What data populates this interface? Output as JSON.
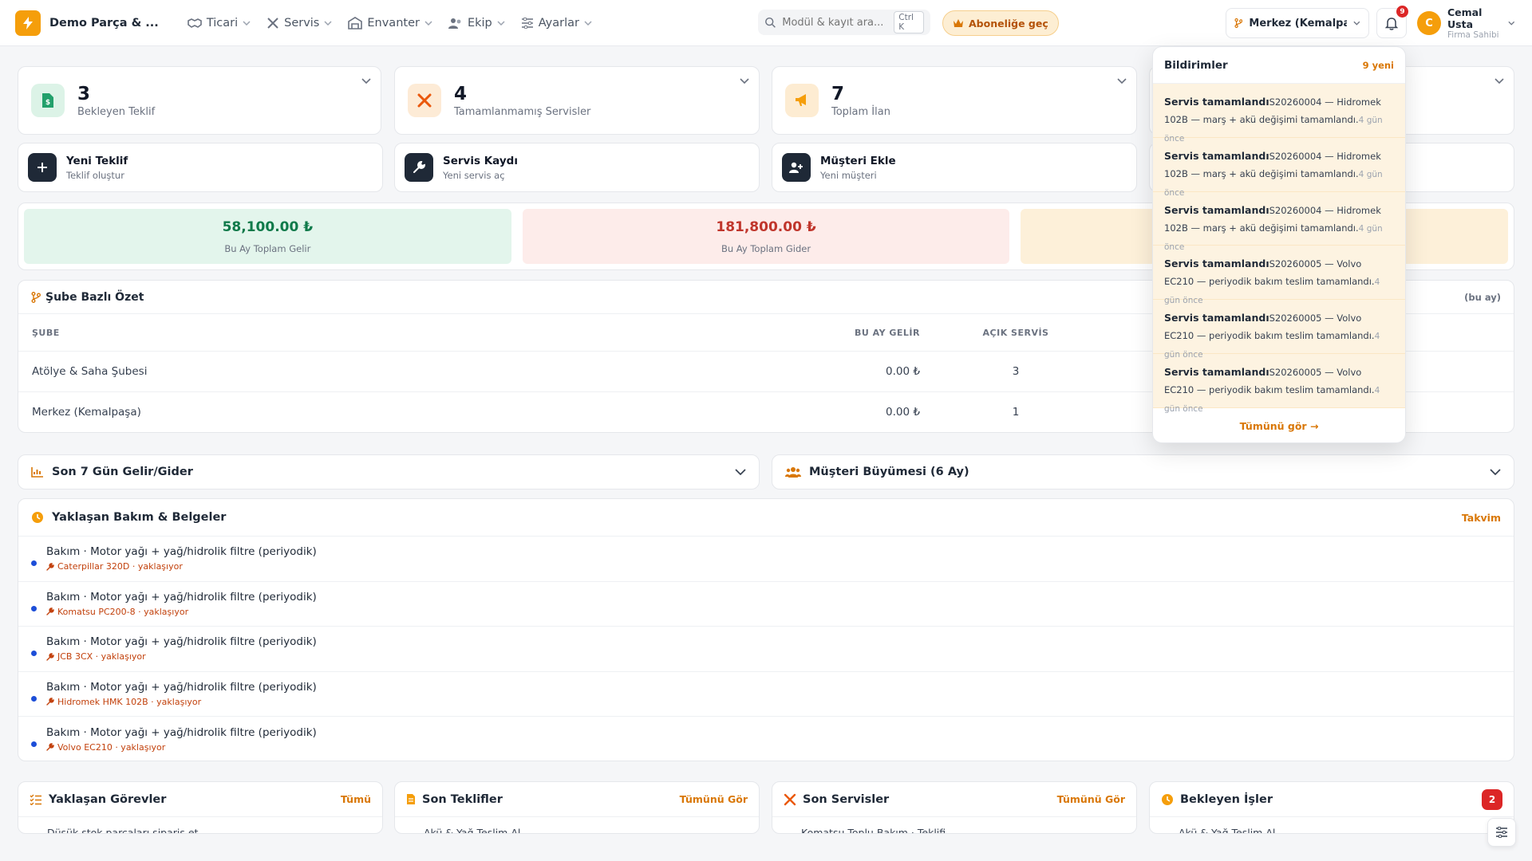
{
  "app": {
    "brand_name": "Demo Parça & ..."
  },
  "nav": [
    {
      "label": "Ticari",
      "icon": "handshake-icon"
    },
    {
      "label": "Servis",
      "icon": "tools-icon"
    },
    {
      "label": "Envanter",
      "icon": "warehouse-icon"
    },
    {
      "label": "Ekip",
      "icon": "team-icon"
    },
    {
      "label": "Ayarlar",
      "icon": "sliders-icon"
    }
  ],
  "search": {
    "placeholder": "Modül & kayıt ara...",
    "shortcut": "Ctrl K"
  },
  "upgrade": {
    "label": "Aboneliğe geç"
  },
  "branch": {
    "selected": "Merkez (Kemalpa..."
  },
  "notifications": {
    "badge": "9",
    "title": "Bildirimler",
    "new_count": "9 yeni",
    "items": [
      {
        "title": "Servis tamamlandı",
        "body": "S20260004 — Hidromek 102B — marş + akü değişimi tamamlandı.",
        "time": "4 gün önce"
      },
      {
        "title": "Servis tamamlandı",
        "body": "S20260004 — Hidromek 102B — marş + akü değişimi tamamlandı.",
        "time": "4 gün önce"
      },
      {
        "title": "Servis tamamlandı",
        "body": "S20260004 — Hidromek 102B — marş + akü değişimi tamamlandı.",
        "time": "4 gün önce"
      },
      {
        "title": "Servis tamamlandı",
        "body": "S20260005 — Volvo EC210 — periyodik bakım teslim tamamlandı.",
        "time": "4 gün önce"
      },
      {
        "title": "Servis tamamlandı",
        "body": "S20260005 — Volvo EC210 — periyodik bakım teslim tamamlandı.",
        "time": "4 gün önce"
      },
      {
        "title": "Servis tamamlandı",
        "body": "S20260005 — Volvo EC210 — periyodik bakım teslim tamamlandı.",
        "time": "4 gün önce"
      }
    ],
    "see_all": "Tümünü gör →"
  },
  "user": {
    "initial": "C",
    "name": "Cemal Usta",
    "role": "Firma Sahibi"
  },
  "stats": [
    {
      "value": "3",
      "label": "Bekleyen Teklif"
    },
    {
      "value": "4",
      "label": "Tamamlanmamış Servisler"
    },
    {
      "value": "7",
      "label": "Toplam İlan"
    }
  ],
  "actions": [
    {
      "title": "Yeni Teklif",
      "sub": "Teklif oluştur"
    },
    {
      "title": "Servis Kaydı",
      "sub": "Yeni servis aç"
    },
    {
      "title": "Müşteri Ekle",
      "sub": "Yeni müşteri"
    }
  ],
  "finance": [
    {
      "value": "58,100.00 ₺",
      "label": "Bu Ay Toplam Gelir",
      "color": "#0f7a4a",
      "bg": "#e3f5ec"
    },
    {
      "value": "181,800.00 ₺",
      "label": "Bu Ay Toplam Gider",
      "color": "#c0362c",
      "bg": "#fdecea"
    }
  ],
  "branch_summary": {
    "title": "Şube Bazlı Özet",
    "period": "(bu ay)",
    "columns": [
      "ŞUBE",
      "BU AY GELİR",
      "AÇIK SERVİS"
    ],
    "rows": [
      {
        "name": "Atölye & Saha Şubesi",
        "gelir": "0.00 ₺",
        "servis": "3"
      },
      {
        "name": "Merkez (Kemalpaşa)",
        "gelir": "0.00 ₺",
        "servis": "1"
      }
    ]
  },
  "collapsibles": {
    "income_expense": "Son 7 Gün Gelir/Gider",
    "customer_growth": "Müşteri Büyümesi (6 Ay)"
  },
  "maintenance": {
    "title": "Yaklaşan Bakım & Belgeler",
    "link": "Takvim",
    "items": [
      {
        "main": "Bakım · Motor yağı + yağ/hidrolik filtre (periyodik)",
        "sub": "Caterpillar 320D · yaklaşıyor"
      },
      {
        "main": "Bakım · Motor yağı + yağ/hidrolik filtre (periyodik)",
        "sub": "Komatsu PC200-8 · yaklaşıyor"
      },
      {
        "main": "Bakım · Motor yağı + yağ/hidrolik filtre (periyodik)",
        "sub": "JCB 3CX · yaklaşıyor"
      },
      {
        "main": "Bakım · Motor yağı + yağ/hidrolik filtre (periyodik)",
        "sub": "Hidromek HMK 102B · yaklaşıyor"
      },
      {
        "main": "Bakım · Motor yağı + yağ/hidrolik filtre (periyodik)",
        "sub": "Volvo EC210 · yaklaşıyor"
      }
    ]
  },
  "bottom_cards": [
    {
      "title": "Yaklaşan Görevler",
      "link": "Tümü",
      "peek": "Düşük stok parçaları sipariş et"
    },
    {
      "title": "Son Teklifler",
      "link": "Tümünü Gör",
      "peek": "Akü & Yağ Teslim Al..."
    },
    {
      "title": "Son Servisler",
      "link": "Tümünü Gör",
      "peek": "Komatsu Toplu Bakım · Teklifi..."
    },
    {
      "title": "Bekleyen İşler",
      "badge": "2",
      "peek": "Akü & Yağ Teslim Al..."
    }
  ],
  "colors": {
    "accent": "#f59e0b",
    "accent_text": "#d97706",
    "dark": "#1f2937"
  }
}
